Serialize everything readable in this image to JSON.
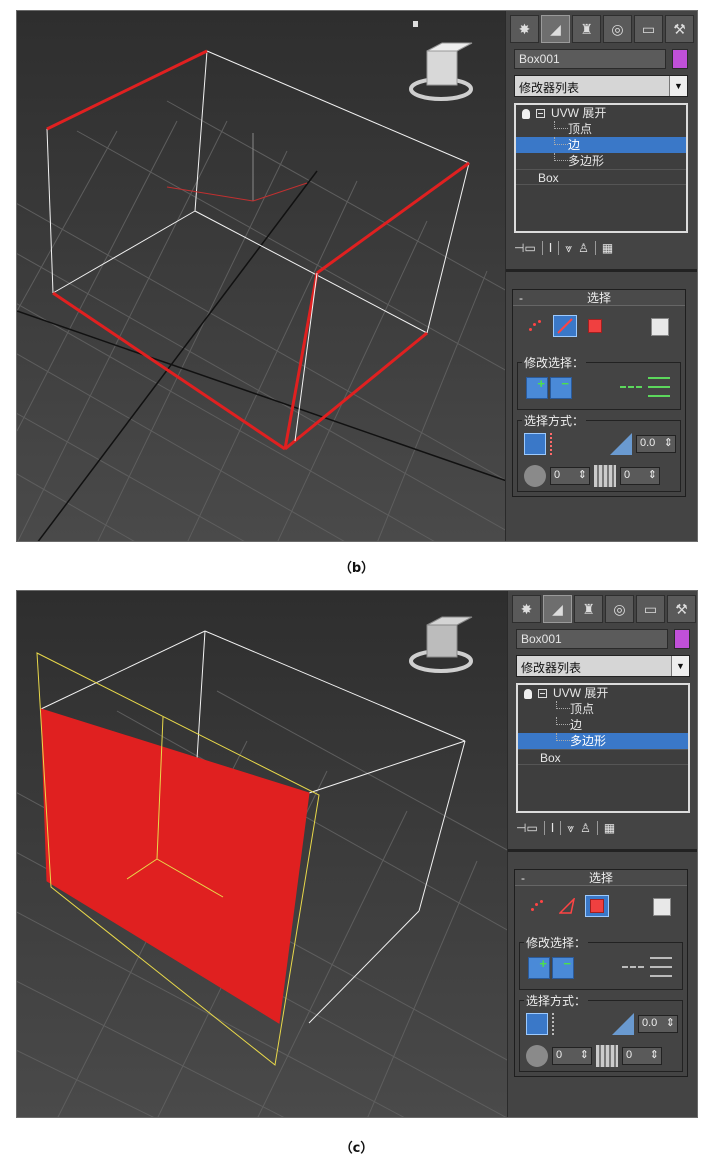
{
  "panels": [
    {
      "object_name": "Box001",
      "object_color": "#c050d8",
      "modifier_list": "修改器列表",
      "stack": {
        "modifier": "UVW 展开",
        "subitems": [
          "顶点",
          "边",
          "多边形"
        ],
        "selected_subitem": "边",
        "base": "Box"
      },
      "rollout_title": "选择",
      "collapse_symbol": "-",
      "modify_selection_label": "修改选择：",
      "select_by_label": "选择方式：",
      "threshold_value": "0.0",
      "ring_value": "0",
      "grid_value": "0",
      "active_mode": "edge",
      "caption": "（b）"
    },
    {
      "object_name": "Box001",
      "object_color": "#c050d8",
      "modifier_list": "修改器列表",
      "stack": {
        "modifier": "UVW 展开",
        "subitems": [
          "顶点",
          "边",
          "多边形"
        ],
        "selected_subitem": "多边形",
        "base": "Box"
      },
      "rollout_title": "选择",
      "collapse_symbol": "-",
      "modify_selection_label": "修改选择：",
      "select_by_label": "选择方式：",
      "threshold_value": "0.0",
      "ring_value": "0",
      "grid_value": "0",
      "active_mode": "polygon",
      "caption": "（c）"
    }
  ],
  "colors": {
    "selection_red": "#e02020",
    "highlight_blue": "#3a78c8",
    "gizmo_yellow": "#e8d84a",
    "viewport_bg": "#3b3b3b"
  },
  "icons": [
    "sun-icon",
    "curve-icon",
    "hierarchy-icon",
    "motion-icon",
    "display-icon",
    "hammer-icon",
    "viewcube-icon"
  ]
}
